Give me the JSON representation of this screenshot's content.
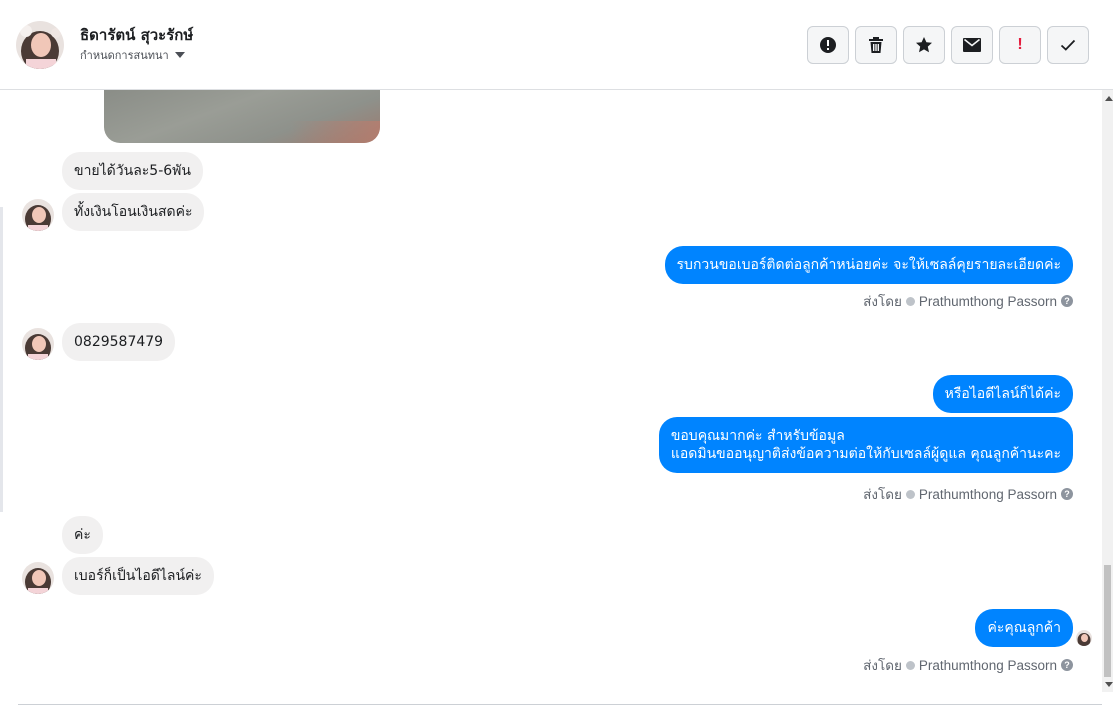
{
  "header": {
    "contact_name": "ธิดารัตน์ สุวะรักษ์",
    "assign_label": "กำหนดการสนทนา",
    "actions": [
      {
        "icon": "alert-circle-icon",
        "name": "mark-spam-button"
      },
      {
        "icon": "trash-icon",
        "name": "delete-button"
      },
      {
        "icon": "star-icon",
        "name": "star-button"
      },
      {
        "icon": "envelope-icon",
        "name": "mark-unread-button"
      },
      {
        "icon": "exclamation-icon",
        "name": "follow-up-button"
      },
      {
        "icon": "check-icon",
        "name": "mark-done-button"
      }
    ]
  },
  "messages": [
    {
      "id": "m1",
      "direction": "in",
      "text": "ขายได้วันละ5-6พัน"
    },
    {
      "id": "m2",
      "direction": "in",
      "text": "ทั้งเงินโอนเงินสดค่ะ"
    },
    {
      "id": "m3",
      "direction": "out",
      "text": "รบกวนขอเบอร์ติดต่อลูกค้าหน่อยค่ะ จะให้เซลล์คุยรายละเอียดค่ะ"
    },
    {
      "id": "m4",
      "direction": "in",
      "text": "0829587479"
    },
    {
      "id": "m5",
      "direction": "out",
      "text": "หรือไอดีไลน์ก็ได้ค่ะ"
    },
    {
      "id": "m6",
      "direction": "out",
      "line1": "ขอบคุณมากค่ะ สำหรับข้อมูล",
      "line2": "แอดมินขออนุญาติส่งข้อความต่อให้กับเซลล์ผู้ดูแล คุณลูกค้านะคะ"
    },
    {
      "id": "m7",
      "direction": "in",
      "text": "ค่ะ"
    },
    {
      "id": "m8",
      "direction": "in",
      "text": "เบอร์ก็เป็นไอดีไลน์ค่ะ"
    },
    {
      "id": "m9",
      "direction": "out",
      "text": "ค่ะคุณลูกค้า"
    }
  ],
  "sent_by": {
    "prefix": "ส่งโดย",
    "agent": "Prathumthong Passorn",
    "help": "?"
  },
  "colors": {
    "outgoing_bubble": "#0084ff",
    "incoming_bubble": "#f1f0f0",
    "follow_up_red": "#e41e3f"
  }
}
